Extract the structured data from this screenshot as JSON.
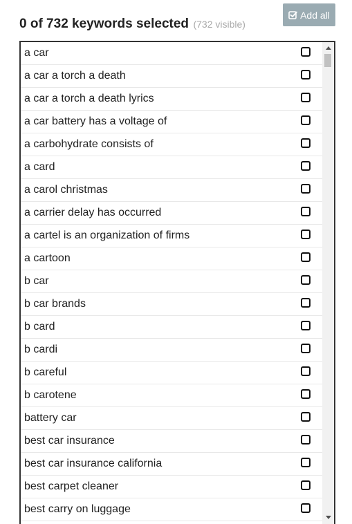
{
  "header": {
    "title": "0 of 732 keywords selected",
    "visible_count": "(732 visible)",
    "add_all_label": "Add all",
    "add_all_icon": "check-square-icon"
  },
  "keywords": [
    "a car",
    "a car a torch a death",
    "a car a torch a death lyrics",
    "a car battery has a voltage of",
    "a carbohydrate consists of",
    "a card",
    "a carol christmas",
    "a carrier delay has occurred",
    "a cartel is an organization of firms",
    "a cartoon",
    "b car",
    "b car brands",
    "b card",
    "b cardi",
    "b careful",
    "b carotene",
    "battery car",
    "best car insurance",
    "best car insurance california",
    "best carpet cleaner",
    "best carry on luggage"
  ],
  "colors": {
    "add_all_bg": "#9aabb2",
    "visible_text": "#aaaaaa",
    "border": "#333333"
  }
}
